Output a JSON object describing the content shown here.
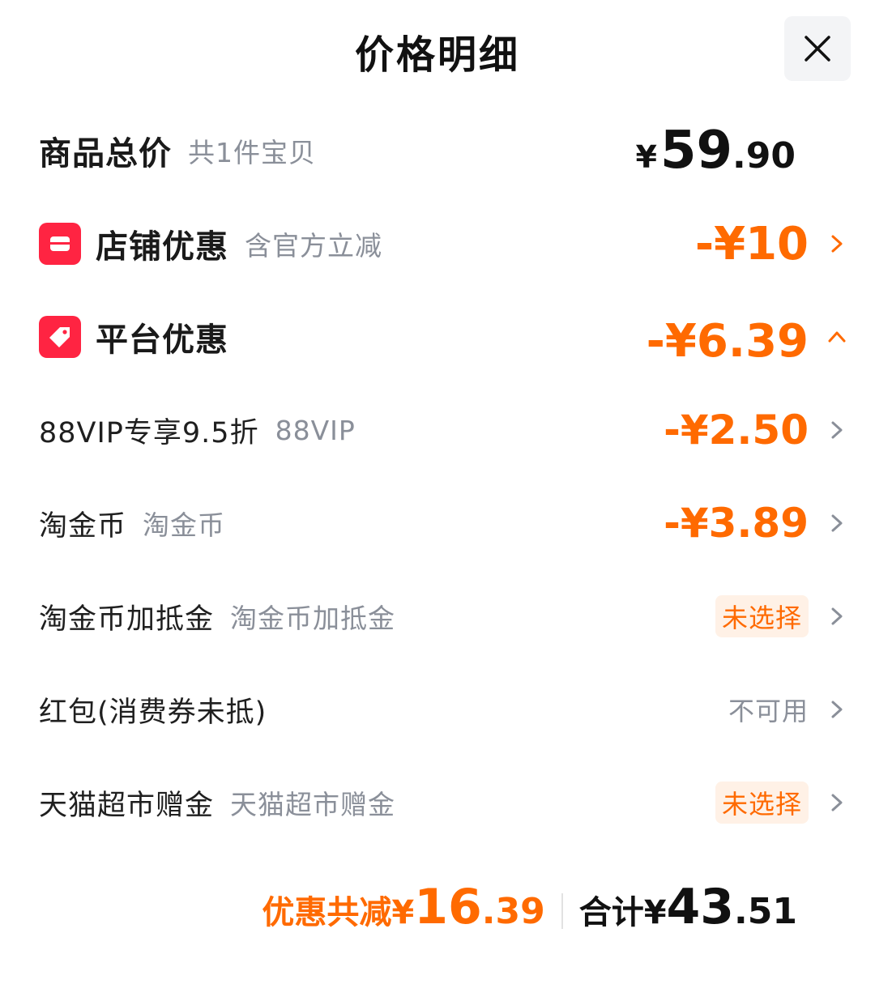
{
  "header": {
    "title": "价格明细",
    "close_icon": "close-icon"
  },
  "summary": {
    "label": "商品总价",
    "note": "共1件宝贝",
    "currency": "¥",
    "price_int": "59",
    "price_dec": ".90"
  },
  "store_discount": {
    "label": "店铺优惠",
    "note": "含官方立减",
    "value": "-¥10",
    "icon": "store-icon",
    "color": "#ff2442"
  },
  "platform_discount": {
    "label": "平台优惠",
    "value": "-¥6.39",
    "icon": "tag-icon",
    "expanded": true
  },
  "items": [
    {
      "label": "88VIP专享9.5折",
      "note": "88VIP",
      "value": "-¥2.50"
    },
    {
      "label": "淘金币",
      "note": "淘金币",
      "value": "-¥3.89"
    },
    {
      "label": "淘金币加抵金",
      "note": "淘金币加抵金",
      "status": "未选择"
    },
    {
      "label": "红包(消费券未抵)",
      "note": "",
      "status": "不可用"
    },
    {
      "label": "天猫超市赠金",
      "note": "天猫超市赠金",
      "status": "未选择"
    }
  ],
  "footer": {
    "saved_label": "优惠共减¥",
    "saved_int": "16",
    "saved_dec": ".39",
    "total_label": "合计¥",
    "total_int": "43",
    "total_dec": ".51"
  },
  "colors": {
    "accent": "#ff6a00",
    "brand_red": "#ff2442",
    "muted": "#8a8f99"
  }
}
